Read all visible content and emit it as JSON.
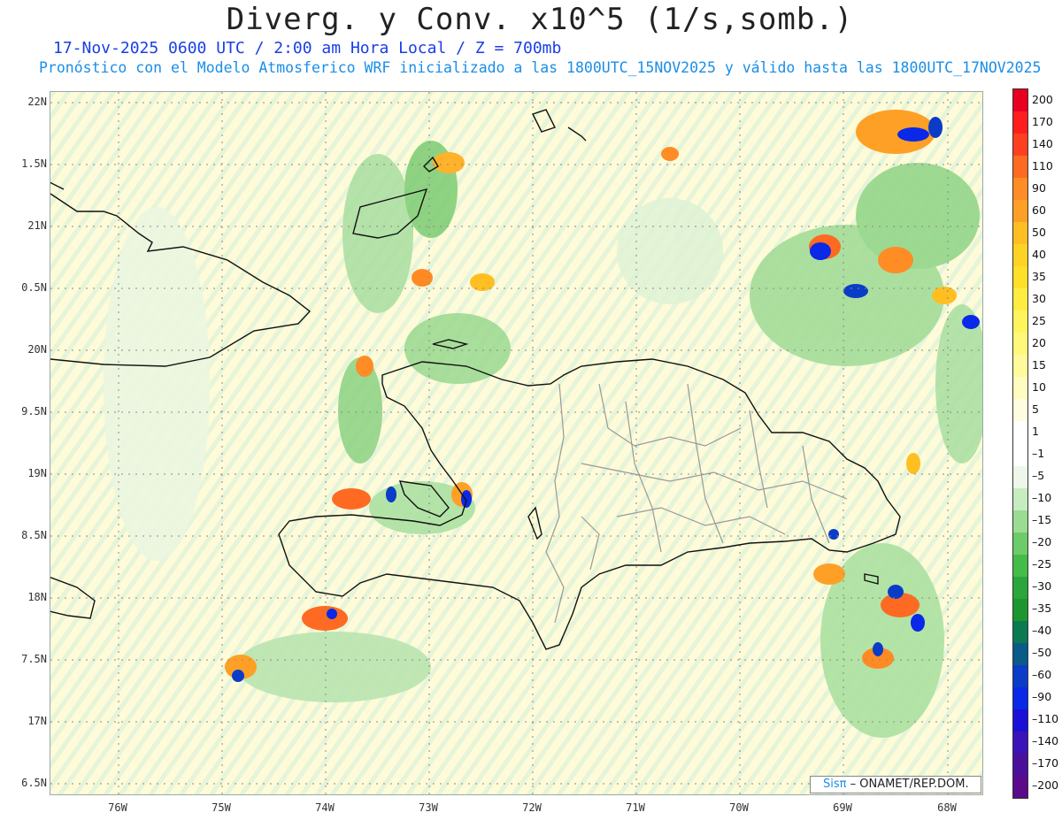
{
  "title": "Diverg. y Conv. x10^5 (1/s,somb.)",
  "subtitle_time": "17-Nov-2025  0600 UTC / 2:00 am Hora Local / Z = 700mb",
  "subtitle_model": "Pronóstico con el Modelo Atmosferico WRF inicializado a las 1800UTC_15NOV2025 y válido hasta las  1800UTC_17NOV2025",
  "lat_labels": [
    "22N",
    "1.5N",
    "21N",
    "0.5N",
    "20N",
    "9.5N",
    "19N",
    "8.5N",
    "18N",
    "7.5N",
    "17N",
    "6.5N"
  ],
  "lon_labels": [
    "76W",
    "75W",
    "74W",
    "73W",
    "72W",
    "71W",
    "70W",
    "69W",
    "68W"
  ],
  "credit_logo": "Sisπ",
  "credit_text": "– ONAMET/REP.DOM.",
  "colorbar": {
    "levels": [
      "200",
      "170",
      "140",
      "110",
      "90",
      "60",
      "50",
      "40",
      "35",
      "30",
      "25",
      "20",
      "15",
      "10",
      "5",
      "1",
      "–1",
      "–5",
      "–10",
      "–15",
      "–20",
      "–25",
      "–30",
      "–35",
      "–40",
      "–50",
      "–60",
      "–90",
      "–110",
      "–140",
      "–170",
      "–200"
    ],
    "colors": [
      "#e8001e",
      "#ff1e1e",
      "#ff4020",
      "#ff6a22",
      "#ff8c24",
      "#ffa026",
      "#ffbe22",
      "#ffd226",
      "#ffe028",
      "#ffec40",
      "#fff45c",
      "#fff87a",
      "#fffa9c",
      "#fffcc0",
      "#fffde0",
      "#ffffff",
      "#ffffff",
      "#eef8ea",
      "#c6ecc0",
      "#9adc92",
      "#6ccc6a",
      "#44bc48",
      "#2aa63a",
      "#1e9630",
      "#0c7a50",
      "#0a5a8a",
      "#0a3cc8",
      "#0a28e8",
      "#1a10d8",
      "#3a14b8",
      "#4a109a",
      "#5a0a8a"
    ]
  }
}
